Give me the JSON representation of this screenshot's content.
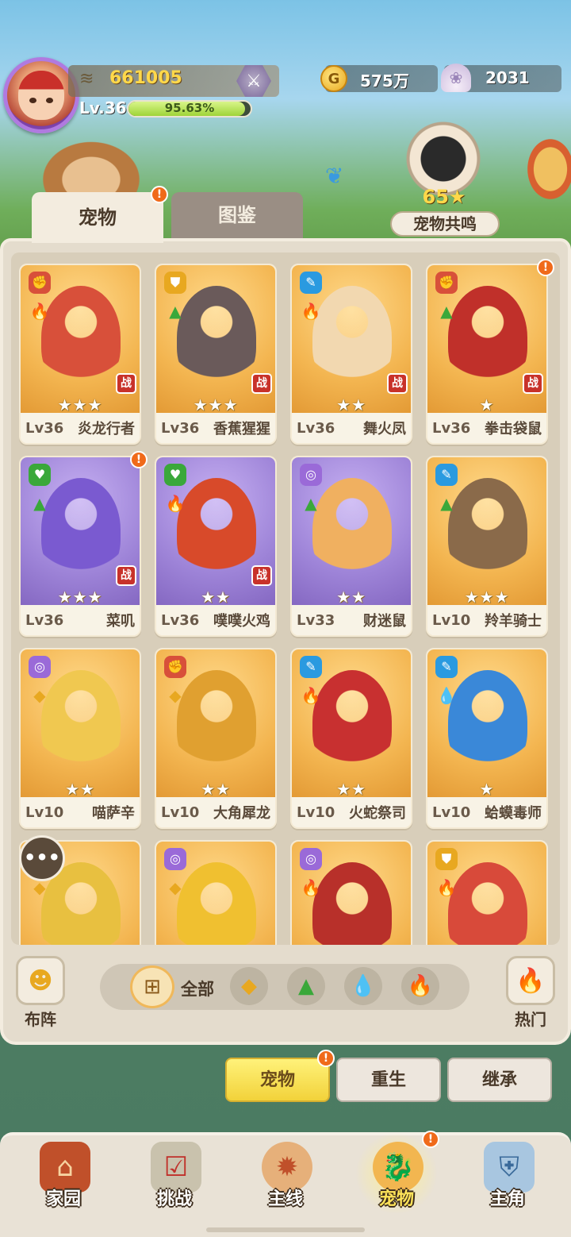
{
  "player": {
    "power": "661005",
    "level": "Lv.36",
    "exp_percent": "95.63%",
    "exp_fraction": 0.9563
  },
  "currency": {
    "coins": "575万",
    "shells": "2031"
  },
  "resonance": {
    "count": "65★",
    "label": "宠物共鸣"
  },
  "tabs": [
    {
      "label": "宠物",
      "active": true
    },
    {
      "label": "图鉴",
      "active": false
    }
  ],
  "pets": [
    {
      "level": "Lv36",
      "name": "炎龙行者",
      "stars": "★★★",
      "bg": "orange",
      "cat": "fist",
      "element": "fire",
      "battle": "战",
      "alert": false
    },
    {
      "level": "Lv36",
      "name": "香蕉猩猩",
      "stars": "★★★",
      "bg": "orange",
      "cat": "shield",
      "element": "grass",
      "battle": "战",
      "alert": false
    },
    {
      "level": "Lv36",
      "name": "舞火凤",
      "stars": "★★",
      "bg": "orange",
      "cat": "wand",
      "element": "fire",
      "battle": "战",
      "alert": false
    },
    {
      "level": "Lv36",
      "name": "拳击袋鼠",
      "stars": "★",
      "bg": "orange",
      "cat": "fist",
      "element": "grass",
      "battle": "战",
      "alert": true
    },
    {
      "level": "Lv36",
      "name": "菜叽",
      "stars": "★★★",
      "bg": "purple",
      "cat": "heart",
      "element": "grass",
      "battle": "战",
      "alert": true
    },
    {
      "level": "Lv36",
      "name": "噗噗火鸡",
      "stars": "★★",
      "bg": "purple",
      "cat": "heart",
      "element": "fire",
      "battle": "战",
      "alert": false
    },
    {
      "level": "Lv33",
      "name": "财迷鼠",
      "stars": "★★",
      "bg": "purple",
      "cat": "swirl",
      "element": "grass",
      "battle": "",
      "alert": false
    },
    {
      "level": "Lv10",
      "name": "羚羊骑士",
      "stars": "★★★",
      "bg": "orange",
      "cat": "wand",
      "element": "grass",
      "battle": "",
      "alert": false
    },
    {
      "level": "Lv10",
      "name": "喵萨辛",
      "stars": "★★",
      "bg": "orange",
      "cat": "swirl",
      "element": "earth",
      "battle": "",
      "alert": false
    },
    {
      "level": "Lv10",
      "name": "大角犀龙",
      "stars": "★★",
      "bg": "orange",
      "cat": "fist",
      "element": "earth",
      "battle": "",
      "alert": false
    },
    {
      "level": "Lv10",
      "name": "火蛇祭司",
      "stars": "★★",
      "bg": "orange",
      "cat": "wand",
      "element": "fire",
      "battle": "",
      "alert": false
    },
    {
      "level": "Lv10",
      "name": "蛤蟆毒师",
      "stars": "★",
      "bg": "orange",
      "cat": "wand",
      "element": "water",
      "battle": "",
      "alert": false
    },
    {
      "level": "",
      "name": "",
      "stars": "",
      "bg": "orange",
      "cat": "",
      "element": "earth",
      "battle": "",
      "alert": false
    },
    {
      "level": "",
      "name": "",
      "stars": "",
      "bg": "orange",
      "cat": "swirl",
      "element": "earth",
      "battle": "",
      "alert": false
    },
    {
      "level": "",
      "name": "",
      "stars": "",
      "bg": "orange",
      "cat": "swirl",
      "element": "fire",
      "battle": "",
      "alert": false
    },
    {
      "level": "",
      "name": "",
      "stars": "",
      "bg": "orange",
      "cat": "shield",
      "element": "fire",
      "battle": "",
      "alert": false
    }
  ],
  "filters": {
    "formation_label": "布阵",
    "all_label": "全部",
    "hot_label": "热门",
    "elements": [
      "earth",
      "grass",
      "water",
      "fire"
    ]
  },
  "actions": [
    {
      "label": "宠物",
      "active": true,
      "alert": true
    },
    {
      "label": "重生",
      "active": false,
      "alert": false
    },
    {
      "label": "继承",
      "active": false,
      "alert": false
    }
  ],
  "nav": [
    {
      "label": "家园",
      "icon": "home-icon",
      "active": false,
      "alert": false
    },
    {
      "label": "挑战",
      "icon": "challenge-icon",
      "active": false,
      "alert": false
    },
    {
      "label": "主线",
      "icon": "mainline-icon",
      "active": false,
      "alert": false
    },
    {
      "label": "宠物",
      "icon": "pet-icon",
      "active": true,
      "alert": true
    },
    {
      "label": "主角",
      "icon": "hero-icon",
      "active": false,
      "alert": false
    }
  ],
  "colors": {
    "fire": "#e8502a",
    "grass": "#3aa83a",
    "water": "#2a9ae0",
    "earth": "#e8a820",
    "alert": "#f06a1a"
  }
}
